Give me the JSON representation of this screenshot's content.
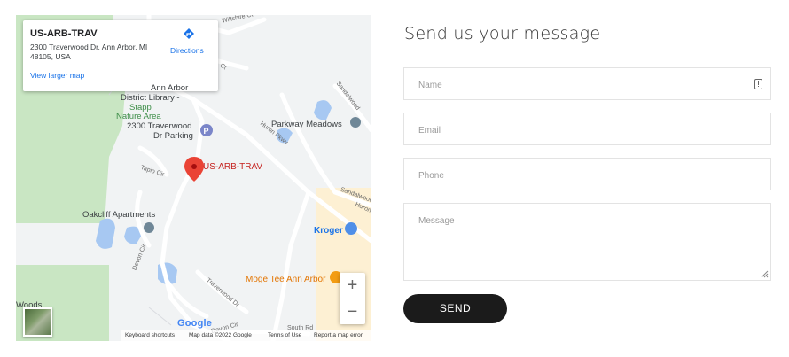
{
  "map": {
    "infocard": {
      "title": "US-ARB-TRAV",
      "address": "2300 Traverwood Dr, Ann Arbor, MI 48105, USA",
      "directions_label": "Directions",
      "view_larger_label": "View larger map"
    },
    "labels": {
      "district_library_1": "Ann Arbor",
      "district_library_2": "District Library -",
      "stapp_1": "Stapp",
      "stapp_2": "Nature Area",
      "parking_1": "2300 Traverwood",
      "parking_2": "Dr Parking",
      "parkway": "Parkway Meadows",
      "marker": "US-ARB-TRAV",
      "oakcliff": "Oakcliff Apartments",
      "kroger": "Kroger",
      "moge": "Möge Tee Ann Arbor",
      "woods": "Woods"
    },
    "roads": {
      "huron_pkwy": "Huron Pkwy",
      "sandalwood_1": "Sandalwood",
      "sandalwood_2": "Sandalwood",
      "huron": "Huron",
      "tapio": "Tapio Cir",
      "devon_cir_1": "Devon Cir",
      "devon_cir_2": "Devon Cir",
      "traverwood": "Traverwood Dr",
      "south_rd": "South Rd",
      "wiltshire": "Wiltshire Ct",
      "ct": "Ct"
    },
    "zoom_in": "+",
    "zoom_out": "−",
    "google_logo": "Google",
    "footer": {
      "shortcuts": "Keyboard shortcuts",
      "data": "Map data ©2022 Google",
      "terms": "Terms of Use",
      "report": "Report a map error"
    }
  },
  "form": {
    "title": "Send us your message",
    "name_placeholder": "Name",
    "email_placeholder": "Email",
    "phone_placeholder": "Phone",
    "message_placeholder": "Message",
    "send_label": "SEND"
  }
}
